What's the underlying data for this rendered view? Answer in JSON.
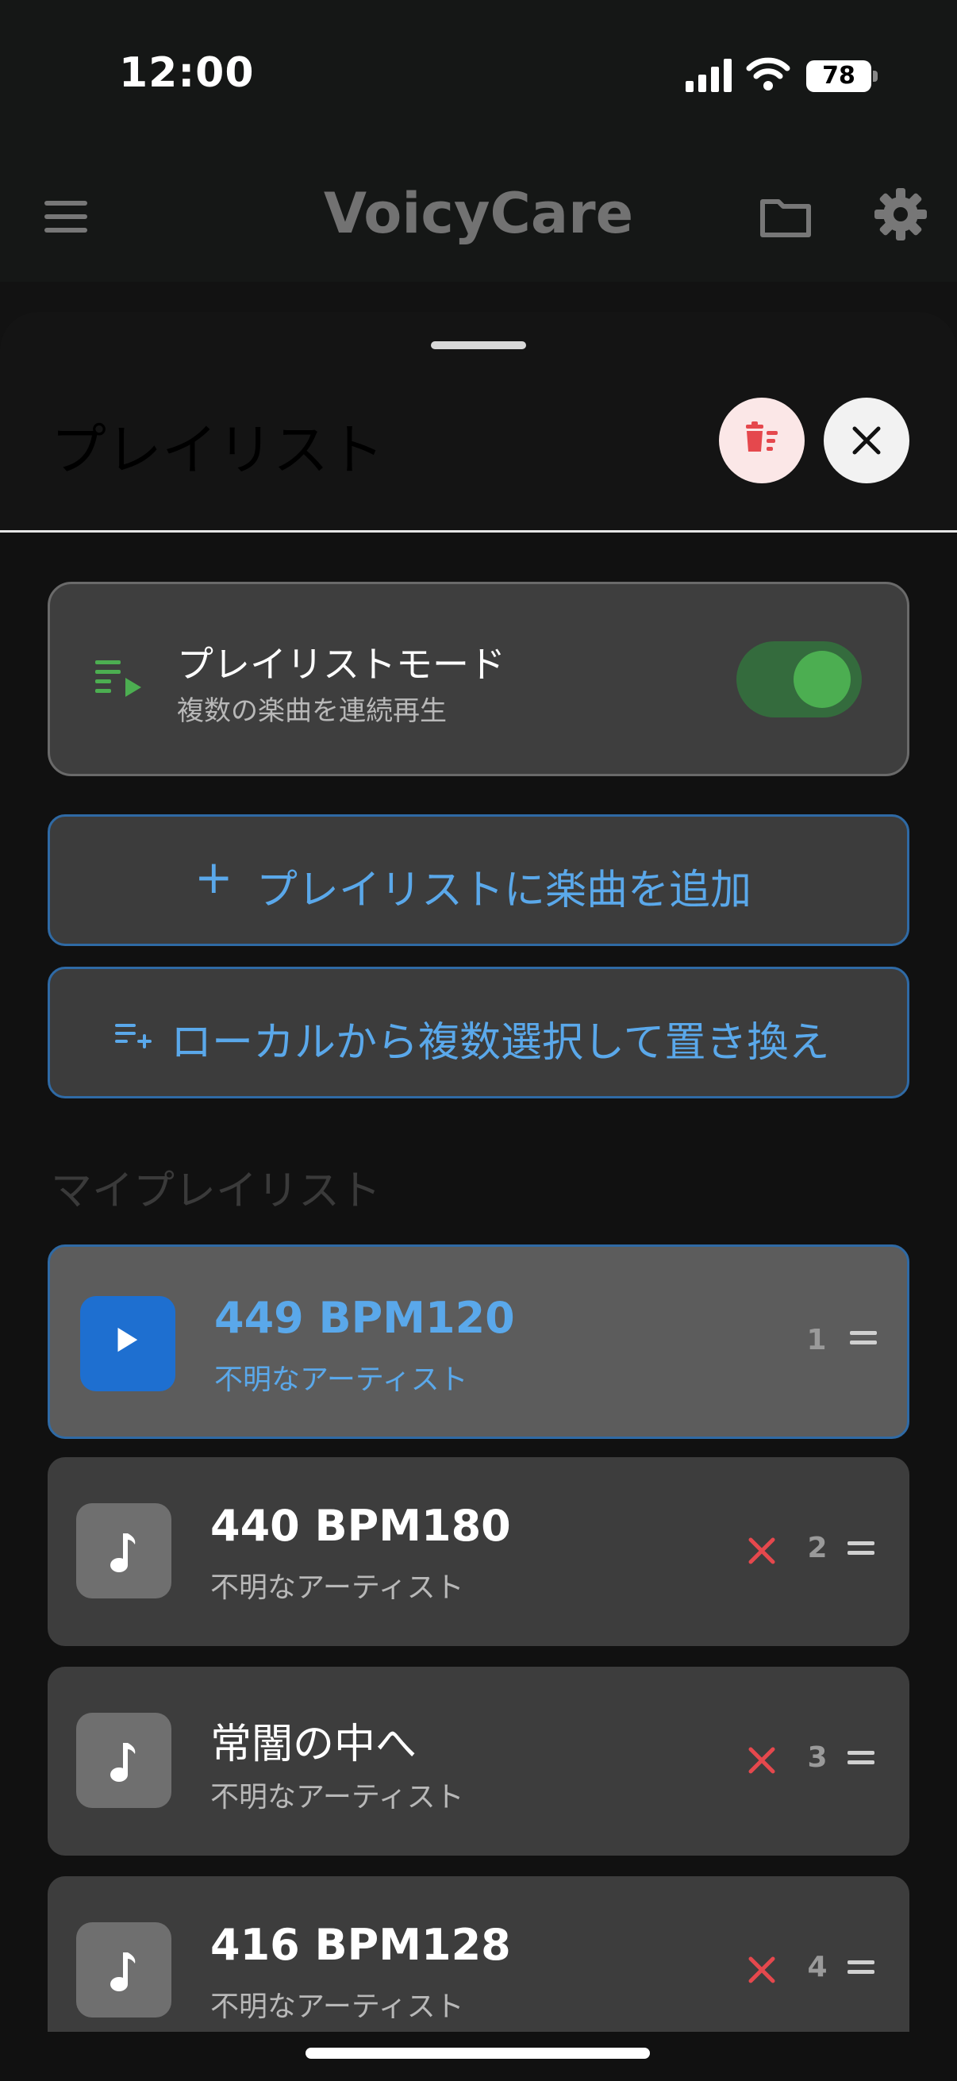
{
  "status_bar": {
    "time": "12:00",
    "battery": "78"
  },
  "header": {
    "title": "VoicyCare",
    "icons": [
      "menu-icon",
      "folder-icon",
      "gear-icon"
    ]
  },
  "sheet": {
    "title": "プレイリスト",
    "playlist_mode": {
      "title": "プレイリストモード",
      "subtitle": "複数の楽曲を連続再生",
      "enabled": true
    },
    "add_button": {
      "icon": "+",
      "label": "プレイリストに楽曲を追加"
    },
    "replace_button": {
      "label": "ローカルから複数選択して置き換え"
    },
    "section_label": "マイプレイリスト",
    "tracks": [
      {
        "title": "449 BPM120",
        "artist": "不明なアーティスト",
        "index": "1",
        "playing": true
      },
      {
        "title": "440 BPM180",
        "artist": "不明なアーティスト",
        "index": "2",
        "playing": false
      },
      {
        "title": "常闇の中へ",
        "artist": "不明なアーティスト",
        "index": "3",
        "playing": false
      },
      {
        "title": "416 BPM128",
        "artist": "不明なアーティスト",
        "index": "4",
        "playing": false
      }
    ]
  },
  "colors": {
    "accent": "#5aa8ea",
    "active_border": "#2f6aa5",
    "toggle_on": "#4cae51",
    "remove": "#e5484d",
    "play_tile": "#1e6fd0"
  }
}
